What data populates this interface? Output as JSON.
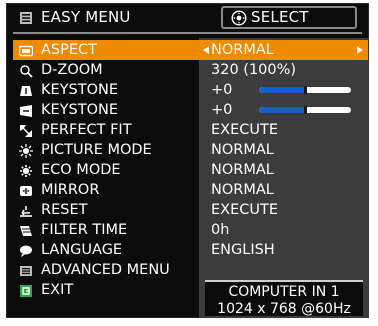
{
  "header": {
    "menu_title": "EASY MENU",
    "select_label": "SELECT",
    "menu_icon": "menu-icon",
    "select_icon": "dpad-icon"
  },
  "menu": {
    "items": [
      {
        "label": "ASPECT",
        "icon": "aspect-icon",
        "value": "NORMAL"
      },
      {
        "label": "D-ZOOM",
        "icon": "zoom-icon",
        "value": "320 (100%)"
      },
      {
        "label": "KEYSTONE",
        "icon": "keystone-vertical-icon",
        "value": "+0"
      },
      {
        "label": "KEYSTONE",
        "icon": "keystone-horizontal-icon",
        "value": "+0"
      },
      {
        "label": "PERFECT FIT",
        "icon": "perfect-fit-icon",
        "value": "EXECUTE"
      },
      {
        "label": "PICTURE MODE",
        "icon": "picture-mode-icon",
        "value": "NORMAL"
      },
      {
        "label": "ECO MODE",
        "icon": "eco-mode-icon",
        "value": "NORMAL"
      },
      {
        "label": "MIRROR",
        "icon": "mirror-icon",
        "value": "NORMAL"
      },
      {
        "label": "RESET",
        "icon": "reset-icon",
        "value": "EXECUTE"
      },
      {
        "label": "FILTER TIME",
        "icon": "filter-icon",
        "value": "0h"
      },
      {
        "label": "LANGUAGE",
        "icon": "language-icon",
        "value": "ENGLISH"
      },
      {
        "label": "ADVANCED MENU",
        "icon": "advanced-menu-icon"
      },
      {
        "label": "EXIT",
        "icon": "exit-icon"
      }
    ],
    "selected_index": 0
  },
  "keystone_sliders": [
    {
      "level": 0.5
    },
    {
      "level": 0.5
    }
  ],
  "source": {
    "input": "COMPUTER IN 1",
    "signal": "1024 x 768 @60Hz"
  },
  "colors": {
    "highlight": "#f08a00",
    "panel": "#3c3c3c",
    "background": "#0b0b0b",
    "slider_fill": "#1560c8"
  }
}
